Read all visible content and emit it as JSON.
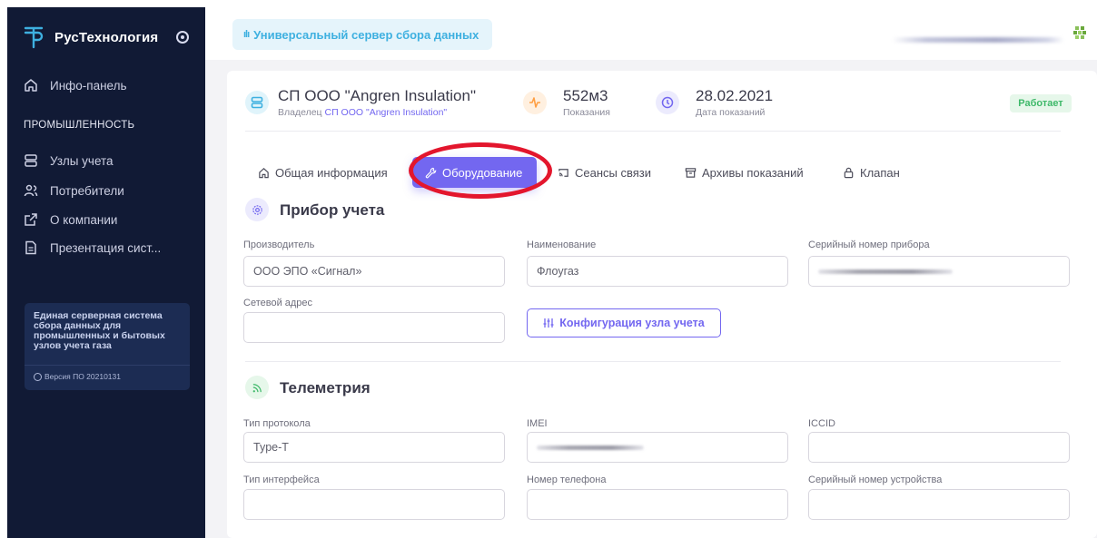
{
  "sidebar": {
    "brand": "РусТехнология",
    "section_label": "ПРОМЫШЛЕННОСТЬ",
    "dashboard": "Инфо-панель",
    "items": [
      {
        "label": "Узлы учета",
        "icon": "server-icon"
      },
      {
        "label": "Потребители",
        "icon": "users-icon"
      },
      {
        "label": "О компании",
        "icon": "external-link-icon"
      },
      {
        "label": "Презентация сист...",
        "icon": "file-icon"
      }
    ],
    "info_card": {
      "text": "Единая серверная система сбора данных для промышленных и бытовых узлов учета газа",
      "version": "Версия ПО 20210131"
    }
  },
  "topbar": {
    "server_label": "Универсальный сервер сбора данных"
  },
  "header": {
    "title": "СП ООО \"Angren Insulation\"",
    "owner_prefix": "Владелец",
    "owner_link": "СП ООО \"Angren Insulation\"",
    "reading_value": "552м3",
    "reading_label": "Показания",
    "date_value": "28.02.2021",
    "date_label": "Дата показаний",
    "status": "Работает"
  },
  "tabs": [
    {
      "label": "Общая информация",
      "icon": "home-icon",
      "active": false
    },
    {
      "label": "Оборудование",
      "icon": "wrench-icon",
      "active": true
    },
    {
      "label": "Сеансы связи",
      "icon": "cast-icon",
      "active": false
    },
    {
      "label": "Архивы показаний",
      "icon": "archive-icon",
      "active": false
    },
    {
      "label": "Клапан",
      "icon": "lock-icon",
      "active": false
    }
  ],
  "device": {
    "title": "Прибор учета",
    "manufacturer_label": "Производитель",
    "manufacturer_value": "ООО ЭПО «Сигнал»",
    "name_label": "Наименование",
    "name_value": "Флоугаз",
    "serial_label": "Серийный номер прибора",
    "network_label": "Сетевой адрес",
    "network_value": "",
    "config_button": "Конфигурация узла учета"
  },
  "telemetry": {
    "title": "Телеметрия",
    "protocol_label": "Тип протокола",
    "protocol_value": "Type-T",
    "imei_label": "IMEI",
    "iccid_label": "ICCID",
    "iccid_value": "",
    "interface_label": "Тип интерфейса",
    "interface_value": "",
    "phone_label": "Номер телефона",
    "phone_value": "",
    "device_serial_label": "Серийный номер устройства",
    "device_serial_value": ""
  },
  "colors": {
    "accent": "#7367f0",
    "sidebar_bg": "#111a35",
    "status_green": "#3fb96a",
    "highlight_ring": "#e3162d",
    "server_badge": "#3eb0e0"
  }
}
